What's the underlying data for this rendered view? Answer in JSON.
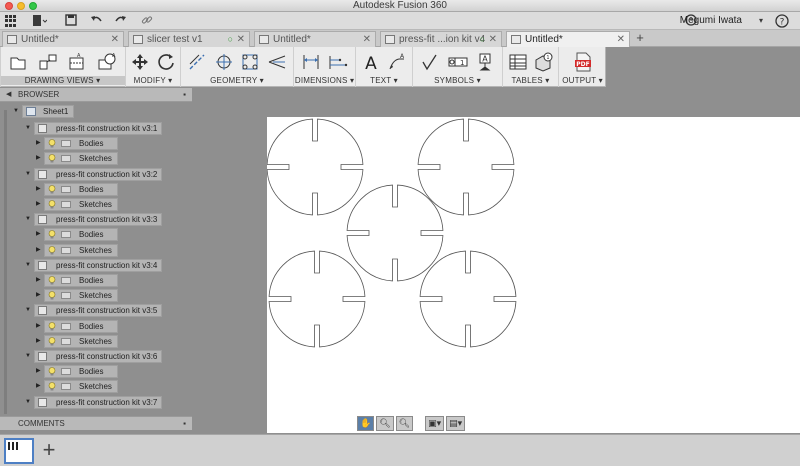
{
  "window": {
    "title": "Autodesk Fusion 360"
  },
  "appbar": {
    "user": "Megumi Iwata"
  },
  "tabs": [
    {
      "label": "Untitled*",
      "active": false
    },
    {
      "label": "slicer test v1",
      "active": false
    },
    {
      "label": "Untitled*",
      "active": false
    },
    {
      "label": "press-fit ...ion kit v4",
      "active": false
    },
    {
      "label": "Untitled*",
      "active": true
    }
  ],
  "toolbar": {
    "groups": [
      {
        "label": "DRAWING VIEWS ▾",
        "active": true
      },
      {
        "label": "MODIFY ▾"
      },
      {
        "label": "GEOMETRY ▾"
      },
      {
        "label": "DIMENSIONS ▾"
      },
      {
        "label": "TEXT ▾"
      },
      {
        "label": "SYMBOLS ▾"
      },
      {
        "label": "TABLES ▾"
      },
      {
        "label": "OUTPUT ▾"
      }
    ],
    "text_tool_glyph": "A",
    "pdf_label": "PDF"
  },
  "browser": {
    "title": "BROWSER",
    "sheet": "Sheet1",
    "components": [
      {
        "name": "press-fit construction kit v3:1",
        "children": [
          "Bodies",
          "Sketches"
        ]
      },
      {
        "name": "press-fit construction kit v3:2",
        "children": [
          "Bodies",
          "Sketches"
        ]
      },
      {
        "name": "press-fit construction kit v3:3",
        "children": [
          "Bodies",
          "Sketches"
        ]
      },
      {
        "name": "press-fit construction kit v3:4",
        "children": [
          "Bodies",
          "Sketches"
        ]
      },
      {
        "name": "press-fit construction kit v3:5",
        "children": [
          "Bodies",
          "Sketches"
        ]
      },
      {
        "name": "press-fit construction kit v3:6",
        "children": [
          "Bodies",
          "Sketches"
        ]
      },
      {
        "name": "press-fit construction kit v3:7",
        "children": []
      }
    ]
  },
  "comments": {
    "title": "COMMENTS"
  },
  "icons": [
    "grid-icon",
    "file-icon",
    "save-icon",
    "undo-icon",
    "redo-icon",
    "link-icon",
    "clock-icon",
    "pin-icon",
    "bulb-icon",
    "folder-icon",
    "hand-icon",
    "zoom-icon",
    "display-icon",
    "pdf-icon"
  ]
}
